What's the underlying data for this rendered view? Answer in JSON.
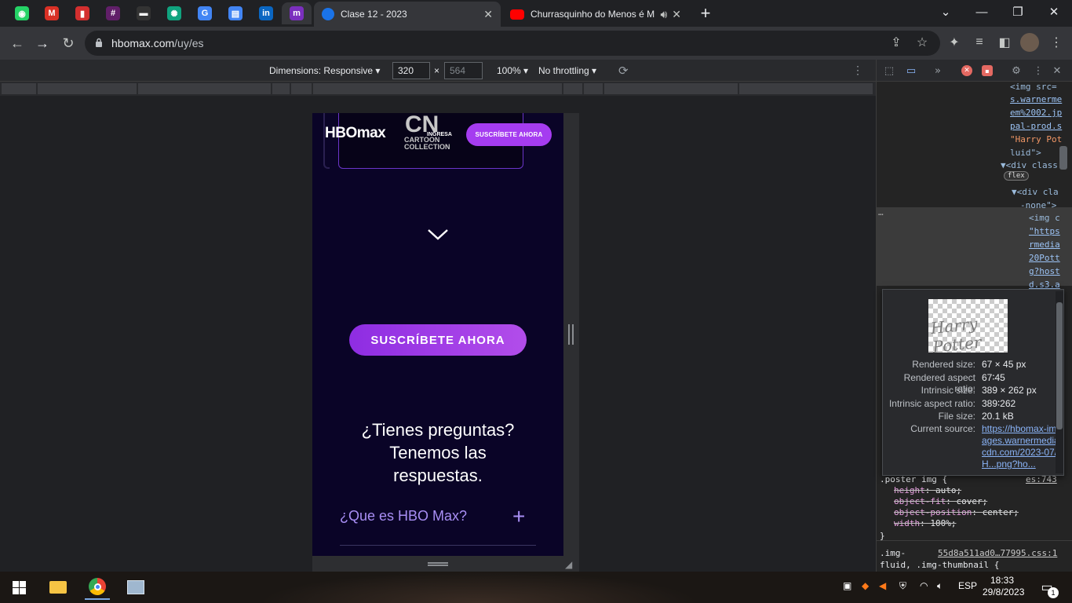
{
  "tabs": {
    "pinned": [
      {
        "name": "whatsapp",
        "color": "#25d366",
        "glyph": "◉"
      },
      {
        "name": "gmail",
        "color": "#d93025",
        "glyph": "M"
      },
      {
        "name": "app-red",
        "color": "#d32f2f",
        "glyph": "▮"
      },
      {
        "name": "slack",
        "color": "#611f69",
        "glyph": "#"
      },
      {
        "name": "app-dark",
        "color": "#333333",
        "glyph": "▬"
      },
      {
        "name": "chatgpt",
        "color": "#10a37f",
        "glyph": "✺"
      },
      {
        "name": "google",
        "color": "#4285f4",
        "glyph": "G"
      },
      {
        "name": "docs",
        "color": "#4285f4",
        "glyph": "▤"
      },
      {
        "name": "linkedin",
        "color": "#0a66c2",
        "glyph": "in"
      },
      {
        "name": "app-m",
        "color": "#7b2fbe",
        "glyph": "m"
      }
    ],
    "active_title": "Clase 12 - 2023",
    "second_title": "Churrasquinho do Menos é M"
  },
  "address": {
    "domain": "hbomax.com",
    "path": "/uy/es"
  },
  "device_toolbar": {
    "dimensions_label": "Dimensions: Responsive",
    "width_value": "320",
    "height_placeholder": "564",
    "times": "×",
    "zoom": "100%",
    "throttle": "No throttling"
  },
  "page": {
    "hbo_logo": "HBOmax",
    "cn_logo": "CN",
    "cn_sub": "CARTOON\nCOLLECTION",
    "ingresa": "INGRESA",
    "subscribe_small": "SUSCRÍBETE AHORA",
    "subscribe_big": "SUSCRÍBETE AHORA",
    "faq_title": "¿Tienes preguntas? Tenemos las respuestas.",
    "faq_question": "¿Que es HBO Max?",
    "faq_plus": "+"
  },
  "devtools": {
    "code_lines": [
      {
        "text": "<img src=",
        "class": ""
      },
      {
        "text": "s.warnerme",
        "class": "link"
      },
      {
        "text": "em%2002.jp",
        "class": "link"
      },
      {
        "text": "pal-prod.s",
        "class": "link"
      },
      {
        "text": "\"Harry Pot",
        "class": "str"
      },
      {
        "text": "luid\">",
        "class": ""
      },
      {
        "text": "▼<div class",
        "class": ""
      },
      {
        "text": "▼<div cla",
        "class": ""
      },
      {
        "text": "-none\">",
        "class": ""
      },
      {
        "text": "<img c",
        "class": ""
      },
      {
        "text": "\"https",
        "class": "link"
      },
      {
        "text": "rmedia",
        "class": "link"
      },
      {
        "text": "20Pott",
        "class": "link"
      },
      {
        "text": "g?host",
        "class": "link"
      },
      {
        "text": "d.s3.a",
        "class": "link"
      }
    ],
    "flex_badge": "flex",
    "ellipsis": "…",
    "css_rule_selector": ".poster img {",
    "css_rule_source": "es:743",
    "css_props": [
      {
        "name": "height",
        "value": "auto;"
      },
      {
        "name": "object-fit",
        "value": "cover;"
      },
      {
        "name": "object-position",
        "value": "center;"
      },
      {
        "name": "width",
        "value": "100%;"
      }
    ],
    "css_close": "}",
    "css_rule2_selector": ".img-",
    "css_rule2_source": "55d8a511ad0…77995.css:1",
    "css_rule2_line2": "fluid, .img-thumbnail {"
  },
  "tooltip": {
    "thumb_text": "Harry Potter",
    "rows": [
      {
        "k": "Rendered size:",
        "v": "67 × 45 px"
      },
      {
        "k": "Rendered aspect ratio:",
        "v": "67∶45"
      },
      {
        "k": "Intrinsic size:",
        "v": "389 × 262 px"
      },
      {
        "k": "Intrinsic aspect ratio:",
        "v": "389∶262"
      },
      {
        "k": "File size:",
        "v": "20.1 kB"
      }
    ],
    "source_label": "Current source:",
    "source_value": "https://hbomax-images.warnermediacdn.com/2023-07/H...png?ho..."
  },
  "taskbar": {
    "lang": "ESP",
    "time": "18:33",
    "date": "29/8/2023",
    "notif_count": "1"
  },
  "colors": {
    "page_bg": "#0a0427",
    "accent_purple": "#a53cf0",
    "faq_purple": "#a88ef4"
  }
}
